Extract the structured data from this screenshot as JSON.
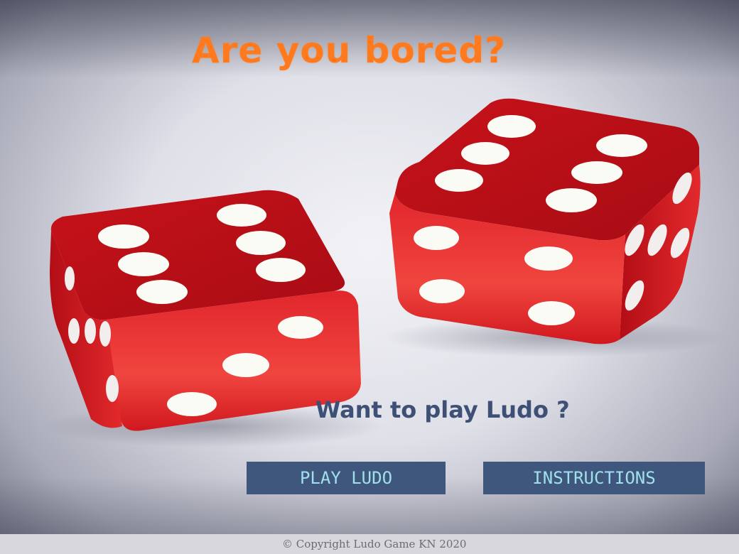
{
  "screen": {
    "headline": "Are you bored?",
    "prompt": "Want to play Ludo ?",
    "hero_image": "red-dice-pair-image"
  },
  "buttons": {
    "play_label": "PLAY LUDO",
    "instructions_label": "INSTRUCTIONS"
  },
  "footer": {
    "copyright": "© Copyright Ludo Game KN 2020"
  },
  "colors": {
    "headline": "#ff7a1e",
    "prompt": "#3e5075",
    "button_bg": "#3f577d",
    "button_text": "#9fe0ea",
    "dice": "#d3151c"
  }
}
